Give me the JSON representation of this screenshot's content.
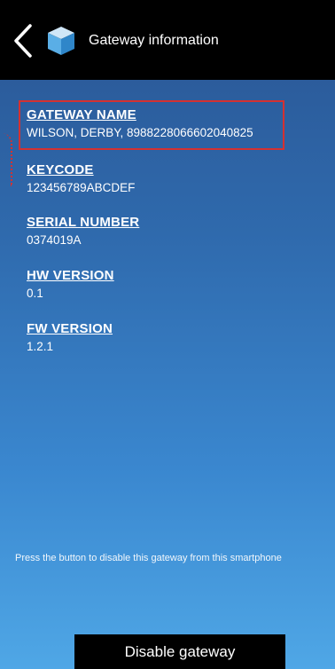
{
  "header": {
    "title": "Gateway information",
    "back_icon": "chevron-left-icon",
    "gateway_icon": "cube-icon"
  },
  "fields": [
    {
      "label": "GATEWAY NAME",
      "value": "WILSON, DERBY, 8988228066602040825"
    },
    {
      "label": "KEYCODE",
      "value": "123456789ABCDEF"
    },
    {
      "label": "SERIAL NUMBER",
      "value": "0374019A"
    },
    {
      "label": "HW VERSION",
      "value": "0.1"
    },
    {
      "label": "FW VERSION",
      "value": "1.2.1"
    }
  ],
  "footer": {
    "note": "Press the button to disable this gateway from this smartphone",
    "disable_button_label": "Disable gateway"
  },
  "colors": {
    "header_bg": "#000000",
    "gradient_top": "#2a5593",
    "gradient_bottom": "#4fa7e6",
    "highlight": "#d43131"
  }
}
